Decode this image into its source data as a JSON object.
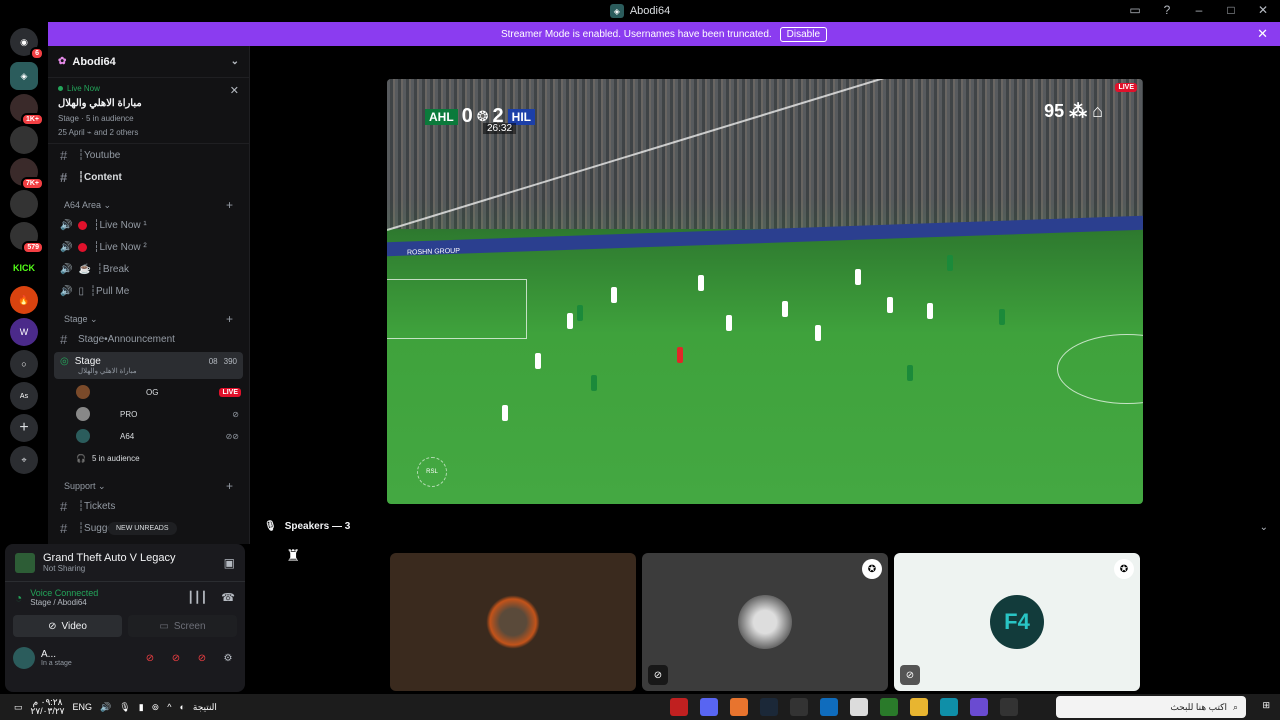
{
  "window": {
    "title": "Abodi64"
  },
  "streamer_banner": {
    "text": "Streamer Mode is enabled. Usernames have been truncated.",
    "button": "Disable"
  },
  "server_rail": {
    "badges": [
      "6",
      "1K+",
      "7K+",
      "579"
    ],
    "kick_label": "KICK"
  },
  "server": {
    "name": "Abodi64"
  },
  "live_card": {
    "status": "Live Now",
    "title": "مباراة الاهلي والهلال",
    "meta": "Stage · 5 in audience",
    "participants": "25 April ⌁ and 2 others"
  },
  "channels": [
    {
      "name": "┆Youtube"
    },
    {
      "name": "┆Content"
    }
  ],
  "categories": {
    "area": "A64 Area",
    "stage": "Stage",
    "support": "Support"
  },
  "voice_channels": [
    {
      "name": "┆Live Now ¹"
    },
    {
      "name": "┆Live Now ²"
    },
    {
      "name": "┆Break"
    },
    {
      "name": "┆Pull Me"
    }
  ],
  "stage_channels": {
    "announcement": "Stage•Announcement",
    "stage_name": "Stage",
    "stage_topic": "مباراة الاهلي والهلال",
    "video_count": "08",
    "listeners": "390"
  },
  "stage_users": [
    {
      "name": "OG",
      "live": "LIVE"
    },
    {
      "name": "PRO"
    },
    {
      "name": "A64"
    }
  ],
  "audience": "5 in audience",
  "support_channels": [
    {
      "name": "┆Tickets"
    },
    {
      "name": "┆Suggestions"
    }
  ],
  "new_unreads": "NEW UNREADS",
  "activity": {
    "game": "Grand Theft Auto V Legacy",
    "status": "Not Sharing"
  },
  "voice": {
    "status": "Voice Connected",
    "location": "Stage / Abodi64"
  },
  "buttons": {
    "video": "Video",
    "screen": "Screen"
  },
  "user": {
    "name": "A...",
    "status": "In a stage"
  },
  "stream": {
    "home_team": "AHL",
    "home_score": "0",
    "away_team": "HIL",
    "away_score": "2",
    "clock": "26:32",
    "broadcaster": "95",
    "live": "LIVE",
    "board_text": "ROSHN GROUP",
    "watermark": "RSL"
  },
  "speakers": {
    "header": "Speakers — 3"
  },
  "taskbar": {
    "time": "٠٩:٢٨ م",
    "date": "٢٧/٠٣/٢٧",
    "lang": "ENG",
    "result_label": "النتيجة",
    "search_placeholder": "اكتب هنا للبحث"
  }
}
